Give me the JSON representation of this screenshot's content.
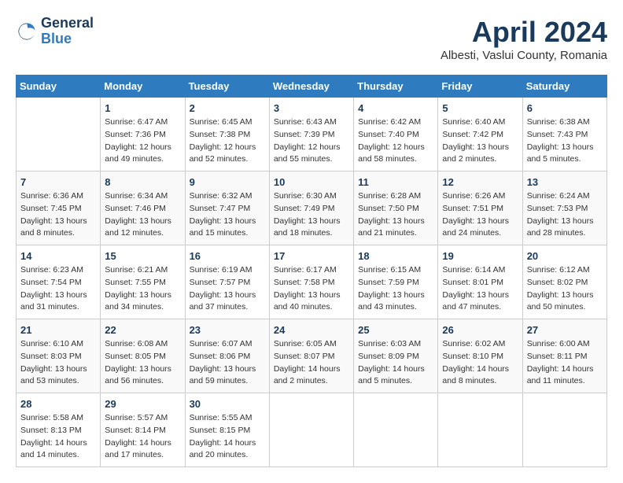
{
  "header": {
    "logo_general": "General",
    "logo_blue": "Blue",
    "month": "April 2024",
    "location": "Albesti, Vaslui County, Romania"
  },
  "calendar": {
    "days_of_week": [
      "Sunday",
      "Monday",
      "Tuesday",
      "Wednesday",
      "Thursday",
      "Friday",
      "Saturday"
    ],
    "weeks": [
      [
        {
          "day": "",
          "info": ""
        },
        {
          "day": "1",
          "info": "Sunrise: 6:47 AM\nSunset: 7:36 PM\nDaylight: 12 hours\nand 49 minutes."
        },
        {
          "day": "2",
          "info": "Sunrise: 6:45 AM\nSunset: 7:38 PM\nDaylight: 12 hours\nand 52 minutes."
        },
        {
          "day": "3",
          "info": "Sunrise: 6:43 AM\nSunset: 7:39 PM\nDaylight: 12 hours\nand 55 minutes."
        },
        {
          "day": "4",
          "info": "Sunrise: 6:42 AM\nSunset: 7:40 PM\nDaylight: 12 hours\nand 58 minutes."
        },
        {
          "day": "5",
          "info": "Sunrise: 6:40 AM\nSunset: 7:42 PM\nDaylight: 13 hours\nand 2 minutes."
        },
        {
          "day": "6",
          "info": "Sunrise: 6:38 AM\nSunset: 7:43 PM\nDaylight: 13 hours\nand 5 minutes."
        }
      ],
      [
        {
          "day": "7",
          "info": "Sunrise: 6:36 AM\nSunset: 7:45 PM\nDaylight: 13 hours\nand 8 minutes."
        },
        {
          "day": "8",
          "info": "Sunrise: 6:34 AM\nSunset: 7:46 PM\nDaylight: 13 hours\nand 12 minutes."
        },
        {
          "day": "9",
          "info": "Sunrise: 6:32 AM\nSunset: 7:47 PM\nDaylight: 13 hours\nand 15 minutes."
        },
        {
          "day": "10",
          "info": "Sunrise: 6:30 AM\nSunset: 7:49 PM\nDaylight: 13 hours\nand 18 minutes."
        },
        {
          "day": "11",
          "info": "Sunrise: 6:28 AM\nSunset: 7:50 PM\nDaylight: 13 hours\nand 21 minutes."
        },
        {
          "day": "12",
          "info": "Sunrise: 6:26 AM\nSunset: 7:51 PM\nDaylight: 13 hours\nand 24 minutes."
        },
        {
          "day": "13",
          "info": "Sunrise: 6:24 AM\nSunset: 7:53 PM\nDaylight: 13 hours\nand 28 minutes."
        }
      ],
      [
        {
          "day": "14",
          "info": "Sunrise: 6:23 AM\nSunset: 7:54 PM\nDaylight: 13 hours\nand 31 minutes."
        },
        {
          "day": "15",
          "info": "Sunrise: 6:21 AM\nSunset: 7:55 PM\nDaylight: 13 hours\nand 34 minutes."
        },
        {
          "day": "16",
          "info": "Sunrise: 6:19 AM\nSunset: 7:57 PM\nDaylight: 13 hours\nand 37 minutes."
        },
        {
          "day": "17",
          "info": "Sunrise: 6:17 AM\nSunset: 7:58 PM\nDaylight: 13 hours\nand 40 minutes."
        },
        {
          "day": "18",
          "info": "Sunrise: 6:15 AM\nSunset: 7:59 PM\nDaylight: 13 hours\nand 43 minutes."
        },
        {
          "day": "19",
          "info": "Sunrise: 6:14 AM\nSunset: 8:01 PM\nDaylight: 13 hours\nand 47 minutes."
        },
        {
          "day": "20",
          "info": "Sunrise: 6:12 AM\nSunset: 8:02 PM\nDaylight: 13 hours\nand 50 minutes."
        }
      ],
      [
        {
          "day": "21",
          "info": "Sunrise: 6:10 AM\nSunset: 8:03 PM\nDaylight: 13 hours\nand 53 minutes."
        },
        {
          "day": "22",
          "info": "Sunrise: 6:08 AM\nSunset: 8:05 PM\nDaylight: 13 hours\nand 56 minutes."
        },
        {
          "day": "23",
          "info": "Sunrise: 6:07 AM\nSunset: 8:06 PM\nDaylight: 13 hours\nand 59 minutes."
        },
        {
          "day": "24",
          "info": "Sunrise: 6:05 AM\nSunset: 8:07 PM\nDaylight: 14 hours\nand 2 minutes."
        },
        {
          "day": "25",
          "info": "Sunrise: 6:03 AM\nSunset: 8:09 PM\nDaylight: 14 hours\nand 5 minutes."
        },
        {
          "day": "26",
          "info": "Sunrise: 6:02 AM\nSunset: 8:10 PM\nDaylight: 14 hours\nand 8 minutes."
        },
        {
          "day": "27",
          "info": "Sunrise: 6:00 AM\nSunset: 8:11 PM\nDaylight: 14 hours\nand 11 minutes."
        }
      ],
      [
        {
          "day": "28",
          "info": "Sunrise: 5:58 AM\nSunset: 8:13 PM\nDaylight: 14 hours\nand 14 minutes."
        },
        {
          "day": "29",
          "info": "Sunrise: 5:57 AM\nSunset: 8:14 PM\nDaylight: 14 hours\nand 17 minutes."
        },
        {
          "day": "30",
          "info": "Sunrise: 5:55 AM\nSunset: 8:15 PM\nDaylight: 14 hours\nand 20 minutes."
        },
        {
          "day": "",
          "info": ""
        },
        {
          "day": "",
          "info": ""
        },
        {
          "day": "",
          "info": ""
        },
        {
          "day": "",
          "info": ""
        }
      ]
    ]
  }
}
